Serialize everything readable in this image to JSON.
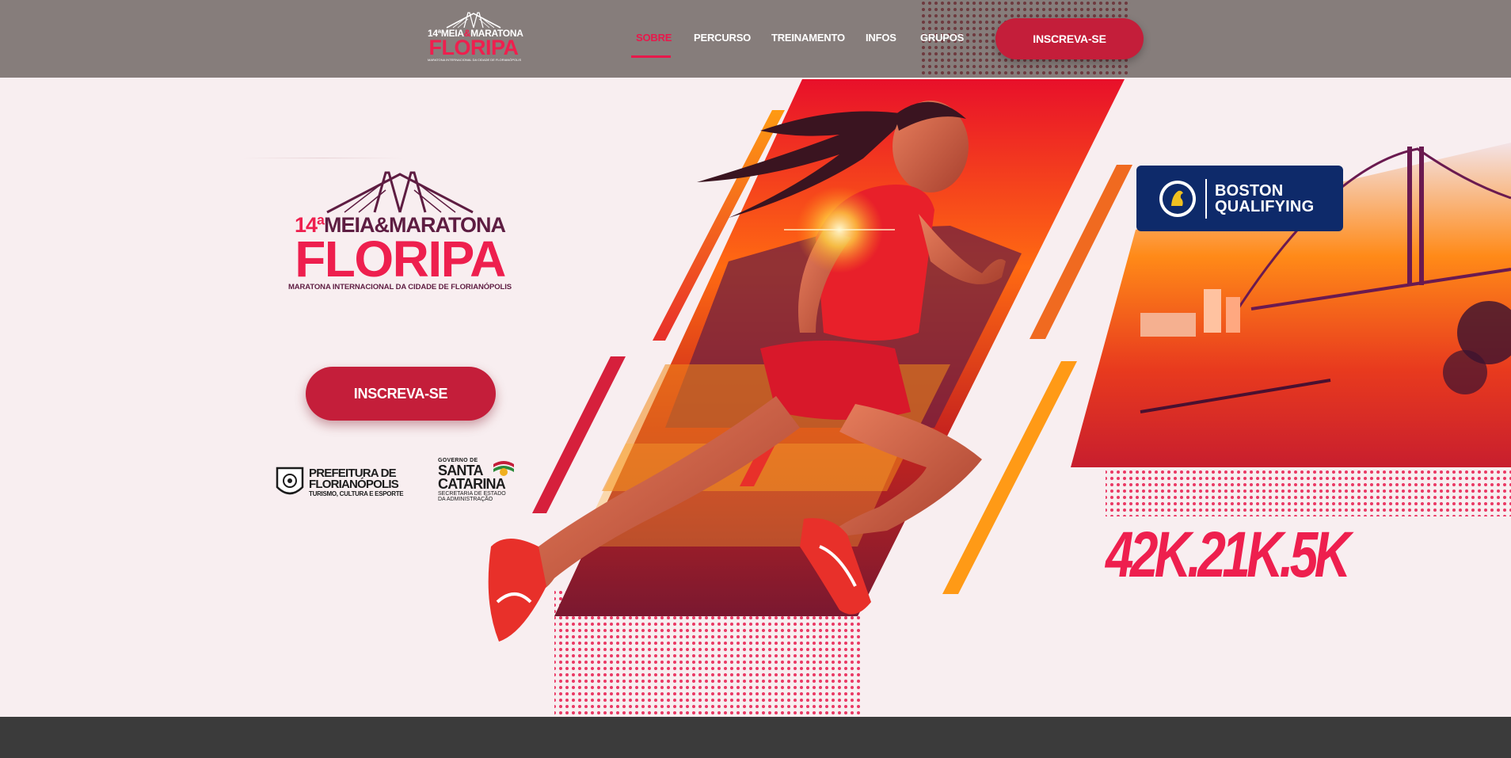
{
  "header": {
    "logo": {
      "line1_prefix": "14ª",
      "line1": "MEIA",
      "amp": "&",
      "line1_rest": "MARATONA",
      "line2": "FLORIPA",
      "line3": "MARATONA INTERNACIONAL DA CIDADE DE FLORIANÓPOLIS"
    },
    "nav": [
      {
        "label": "SOBRE",
        "active": true
      },
      {
        "label": "PERCURSO",
        "active": false
      },
      {
        "label": "TREINAMENTO",
        "active": false
      },
      {
        "label": "INFOS",
        "active": false
      },
      {
        "label": "GRUPOS",
        "active": false
      }
    ],
    "cta": "INSCREVA-SE"
  },
  "hero": {
    "logo": {
      "number": "14ª",
      "line1": "MEIA&MARATONA",
      "line2": "FLORIPA",
      "line3": "MARATONA INTERNACIONAL DA CIDADE DE FLORIANÓPOLIS"
    },
    "cta": "INSCREVA-SE",
    "partners": {
      "prefeitura": {
        "line1": "PREFEITURA DE",
        "line2": "FLORIANÓPOLIS",
        "line3": "TURISMO, CULTURA E ESPORTE"
      },
      "governo": {
        "line1": "GOVERNO DE",
        "line2": "SANTA",
        "line3": "CATARINA",
        "line4": "SECRETARIA DE ESTADO",
        "line5": "DA ADMINISTRAÇÃO"
      }
    },
    "boston": {
      "line1": "BOSTON",
      "line2": "QUALIFYING"
    },
    "distances": "42K.21K.5K"
  },
  "colors": {
    "brand_red": "#ee1f4e",
    "button_red": "#c41e3a",
    "header_bg": "#867d7b",
    "boston_navy": "#0e2a6a",
    "hero_bg": "#f8eef0"
  }
}
